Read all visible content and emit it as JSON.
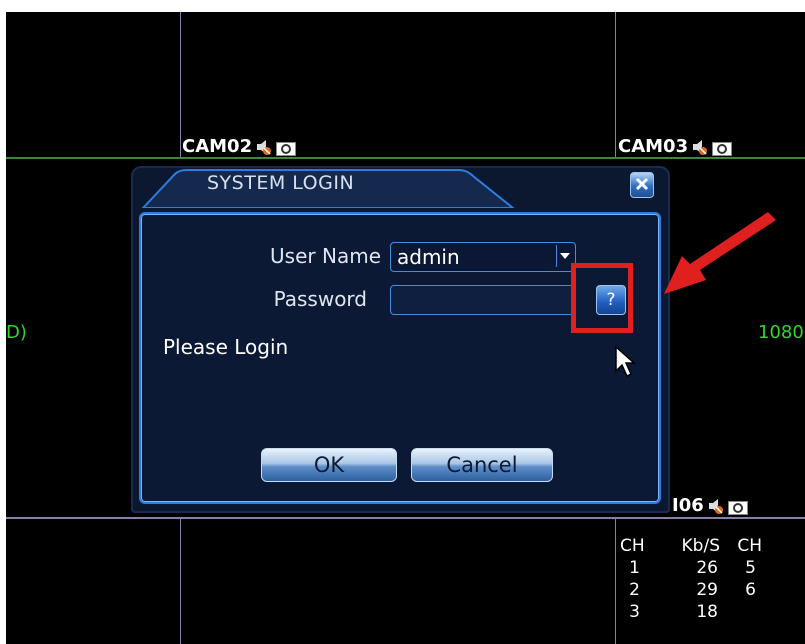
{
  "cameras": {
    "cam02": "CAM02",
    "cam03": "CAM03",
    "cam06": "I06"
  },
  "side_text": {
    "left": "D)",
    "right": "1080"
  },
  "stats": {
    "headers": [
      "CH",
      "Kb/S",
      "CH"
    ],
    "rows": [
      [
        "1",
        "26",
        "5"
      ],
      [
        "2",
        "29",
        "6"
      ],
      [
        "3",
        "18",
        ""
      ]
    ]
  },
  "dialog": {
    "title": "SYSTEM LOGIN",
    "username_label": "User Name",
    "username_value": "admin",
    "password_label": "Password",
    "password_value": "",
    "help_label": "?",
    "status": "Please Login",
    "ok_label": "OK",
    "cancel_label": "Cancel"
  },
  "icons": {
    "close": "close-icon",
    "dropdown": "chevron-down-icon",
    "speaker": "speaker-muted-icon",
    "record": "record-icon",
    "cursor": "mouse-cursor-icon",
    "annotation_arrow": "red-arrow-icon"
  },
  "colors": {
    "grid_purple": "#8a7fa6",
    "grid_green": "#3a8a3a",
    "dialog_border": "#2b7de0",
    "highlight": "#e0201e",
    "side_text": "#2fd62f"
  }
}
